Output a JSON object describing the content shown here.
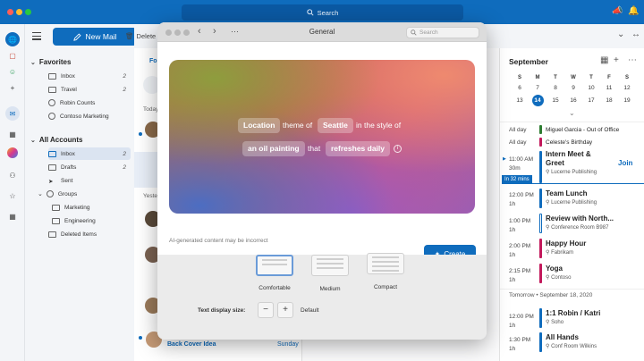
{
  "topbar": {
    "search_label": "Search",
    "colors": {
      "bar": "#0f6cbd",
      "close": "#ff5f57",
      "min": "#febc2e",
      "max": "#28c840"
    }
  },
  "rail": {
    "icons": [
      "globe-icon",
      "document-icon",
      "people-icon",
      "add-icon",
      "mail-icon",
      "calendar-icon",
      "copilot-icon",
      "contacts-icon",
      "favorites-icon",
      "apps-icon"
    ]
  },
  "folders": {
    "new_mail": "New Mail",
    "favorites_header": "Favorites",
    "favorites": [
      {
        "label": "Inbox",
        "count": "2"
      },
      {
        "label": "Travel",
        "count": "2"
      },
      {
        "label": "Robin Counts",
        "count": ""
      },
      {
        "label": "Contoso Marketing",
        "count": ""
      }
    ],
    "accounts_header": "All Accounts",
    "accounts": [
      {
        "label": "Inbox",
        "count": "2"
      },
      {
        "label": "Drafts",
        "count": "2"
      },
      {
        "label": "Sent",
        "count": ""
      },
      {
        "label": "Groups",
        "count": ""
      },
      {
        "label": "Marketing",
        "count": ""
      },
      {
        "label": "Engineering",
        "count": ""
      },
      {
        "label": "Deleted Items",
        "count": ""
      }
    ]
  },
  "toolbar": {
    "delete_label": "Delete"
  },
  "msglist": {
    "tab_fragment": "Fo",
    "today_fragment": "Today",
    "yesterday_fragment": "Yester",
    "bottom_item": {
      "subject": "Back Cover Idea",
      "date": "Sunday"
    }
  },
  "modal": {
    "title": "General",
    "search_placeholder": "Search",
    "hero": {
      "chip_location": "Location",
      "text_theme_of": "theme of",
      "chip_city": "Seattle",
      "text_in_style": "in the style of",
      "chip_style": "an oil painting",
      "text_that": "that",
      "chip_refresh": "refreshes daily"
    },
    "disclaimer": "AI-generated content may be incorrect",
    "create_label": "Create",
    "density": {
      "comfortable": "Comfortable",
      "medium": "Medium",
      "compact": "Compact"
    },
    "text_display_size_label": "Text display size:",
    "text_display_size_value": "Default",
    "minus": "−",
    "plus": "+"
  },
  "calendar": {
    "month": "September",
    "dow": [
      "S",
      "M",
      "T",
      "W",
      "T",
      "F",
      "S"
    ],
    "week1": [
      "6",
      "7",
      "8",
      "9",
      "10",
      "11",
      "12"
    ],
    "week2": [
      "13",
      "14",
      "15",
      "16",
      "17",
      "18",
      "19"
    ],
    "today_index": 1,
    "allday_label": "All day",
    "allday": [
      {
        "title": "Miguel Garcia - Out of Office",
        "color": "#2e7d32"
      },
      {
        "title": "Celeste's Birthday",
        "color": "#c2185b"
      }
    ],
    "events": [
      {
        "time": "11:00 AM",
        "dur": "30m",
        "title": "Intern Meet & Greet",
        "loc": "Lucerne Publishing",
        "color": "#0f6cbd",
        "join": "Join"
      },
      {
        "time": "12:00 PM",
        "dur": "1h",
        "title": "Team Lunch",
        "loc": "Lucerne Publishing",
        "color": "#0f6cbd"
      },
      {
        "time": "1:00 PM",
        "dur": "1h",
        "title": "Review with North...",
        "loc": "Conference Room B987",
        "color": "#0f6cbd"
      },
      {
        "time": "2:00 PM",
        "dur": "1h",
        "title": "Happy Hour",
        "loc": "Fabrikam",
        "color": "#c2185b"
      },
      {
        "time": "2:15 PM",
        "dur": "1h",
        "title": "Yoga",
        "loc": "Contoso",
        "color": "#c2185b"
      }
    ],
    "in_minutes": "In 32 mins",
    "tomorrow_label": "Tomorrow • September 18, 2020",
    "tomorrow_events": [
      {
        "time": "12:00 PM",
        "dur": "1h",
        "title": "1:1 Robin / Katri",
        "loc": "Soho",
        "color": "#0f6cbd"
      },
      {
        "time": "1:30 PM",
        "dur": "1h",
        "title": "All Hands",
        "loc": "Conf Room Wilkins",
        "color": "#0f6cbd"
      }
    ]
  }
}
